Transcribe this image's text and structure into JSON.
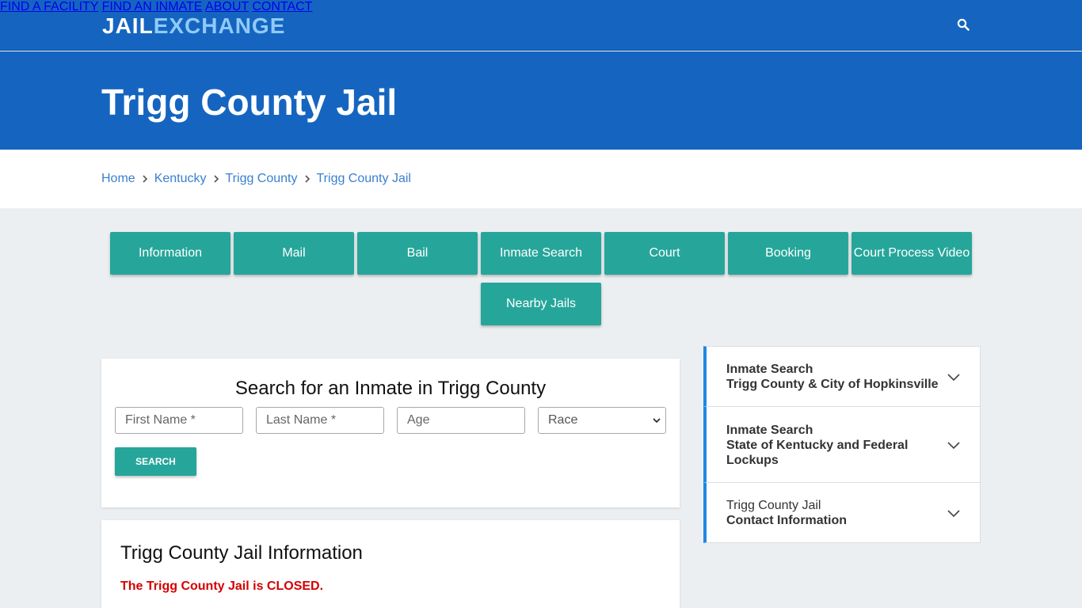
{
  "header": {
    "logo_part1": "JAIL",
    "logo_part2": "EXCHANGE",
    "nav": [
      "FIND A FACILITY",
      "FIND AN INMATE",
      "ABOUT",
      "CONTACT"
    ],
    "search_icon": "search-icon",
    "color_primary": "#1565c0"
  },
  "hero": {
    "title": "Trigg County Jail"
  },
  "breadcrumb": [
    "Home",
    "Kentucky",
    "Trigg County",
    "Trigg County Jail"
  ],
  "tabs": [
    "Information",
    "Mail",
    "Bail",
    "Inmate Search",
    "Court",
    "Booking",
    "Court Process Video",
    "Nearby Jails"
  ],
  "search_card": {
    "title": "Search for an Inmate in Trigg County",
    "first_name_placeholder": "First Name *",
    "last_name_placeholder": "Last Name *",
    "age_placeholder": "Age",
    "race_selected": "Race",
    "button": "SEARCH",
    "accent": "#26a69a"
  },
  "info_card": {
    "title": "Trigg County Jail Information",
    "notice": "The Trigg County Jail is CLOSED."
  },
  "sidebar": [
    {
      "line1": "Inmate Search",
      "line2": "Trigg County & City of Hopkinsville",
      "line3": ""
    },
    {
      "line1": "Inmate Search",
      "line2": "State of Kentucky and Federal",
      "line3": "Lockups"
    },
    {
      "line1": "Trigg County Jail",
      "line2": "Contact Information",
      "line3": ""
    }
  ]
}
